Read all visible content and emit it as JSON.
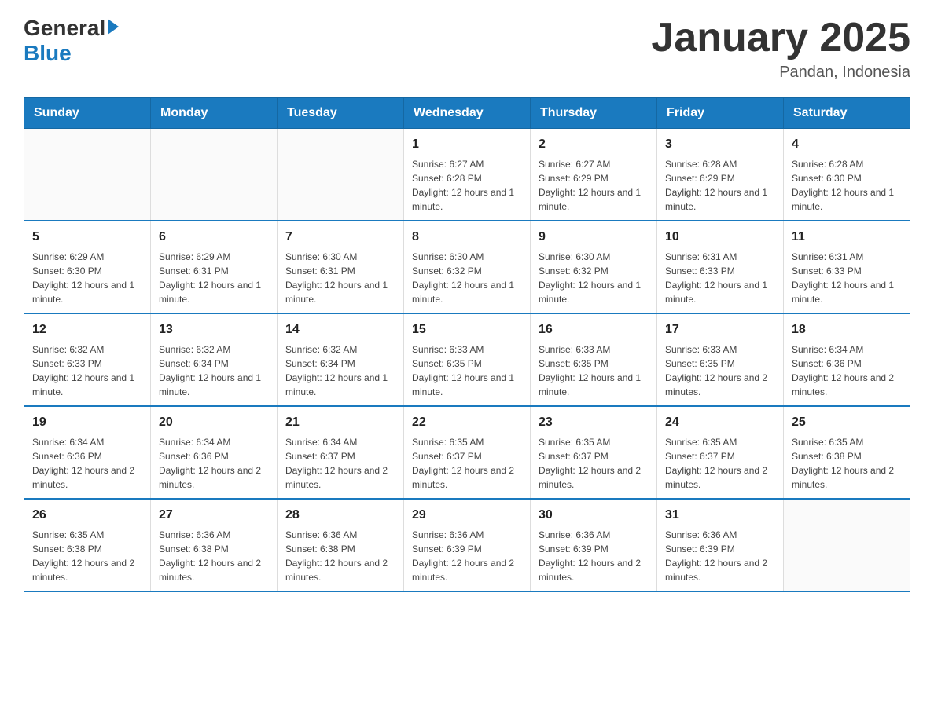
{
  "header": {
    "logo": {
      "general": "General",
      "blue": "Blue"
    },
    "title": "January 2025",
    "subtitle": "Pandan, Indonesia"
  },
  "calendar": {
    "days_of_week": [
      "Sunday",
      "Monday",
      "Tuesday",
      "Wednesday",
      "Thursday",
      "Friday",
      "Saturday"
    ],
    "weeks": [
      [
        {
          "day": "",
          "info": ""
        },
        {
          "day": "",
          "info": ""
        },
        {
          "day": "",
          "info": ""
        },
        {
          "day": "1",
          "info": "Sunrise: 6:27 AM\nSunset: 6:28 PM\nDaylight: 12 hours and 1 minute."
        },
        {
          "day": "2",
          "info": "Sunrise: 6:27 AM\nSunset: 6:29 PM\nDaylight: 12 hours and 1 minute."
        },
        {
          "day": "3",
          "info": "Sunrise: 6:28 AM\nSunset: 6:29 PM\nDaylight: 12 hours and 1 minute."
        },
        {
          "day": "4",
          "info": "Sunrise: 6:28 AM\nSunset: 6:30 PM\nDaylight: 12 hours and 1 minute."
        }
      ],
      [
        {
          "day": "5",
          "info": "Sunrise: 6:29 AM\nSunset: 6:30 PM\nDaylight: 12 hours and 1 minute."
        },
        {
          "day": "6",
          "info": "Sunrise: 6:29 AM\nSunset: 6:31 PM\nDaylight: 12 hours and 1 minute."
        },
        {
          "day": "7",
          "info": "Sunrise: 6:30 AM\nSunset: 6:31 PM\nDaylight: 12 hours and 1 minute."
        },
        {
          "day": "8",
          "info": "Sunrise: 6:30 AM\nSunset: 6:32 PM\nDaylight: 12 hours and 1 minute."
        },
        {
          "day": "9",
          "info": "Sunrise: 6:30 AM\nSunset: 6:32 PM\nDaylight: 12 hours and 1 minute."
        },
        {
          "day": "10",
          "info": "Sunrise: 6:31 AM\nSunset: 6:33 PM\nDaylight: 12 hours and 1 minute."
        },
        {
          "day": "11",
          "info": "Sunrise: 6:31 AM\nSunset: 6:33 PM\nDaylight: 12 hours and 1 minute."
        }
      ],
      [
        {
          "day": "12",
          "info": "Sunrise: 6:32 AM\nSunset: 6:33 PM\nDaylight: 12 hours and 1 minute."
        },
        {
          "day": "13",
          "info": "Sunrise: 6:32 AM\nSunset: 6:34 PM\nDaylight: 12 hours and 1 minute."
        },
        {
          "day": "14",
          "info": "Sunrise: 6:32 AM\nSunset: 6:34 PM\nDaylight: 12 hours and 1 minute."
        },
        {
          "day": "15",
          "info": "Sunrise: 6:33 AM\nSunset: 6:35 PM\nDaylight: 12 hours and 1 minute."
        },
        {
          "day": "16",
          "info": "Sunrise: 6:33 AM\nSunset: 6:35 PM\nDaylight: 12 hours and 1 minute."
        },
        {
          "day": "17",
          "info": "Sunrise: 6:33 AM\nSunset: 6:35 PM\nDaylight: 12 hours and 2 minutes."
        },
        {
          "day": "18",
          "info": "Sunrise: 6:34 AM\nSunset: 6:36 PM\nDaylight: 12 hours and 2 minutes."
        }
      ],
      [
        {
          "day": "19",
          "info": "Sunrise: 6:34 AM\nSunset: 6:36 PM\nDaylight: 12 hours and 2 minutes."
        },
        {
          "day": "20",
          "info": "Sunrise: 6:34 AM\nSunset: 6:36 PM\nDaylight: 12 hours and 2 minutes."
        },
        {
          "day": "21",
          "info": "Sunrise: 6:34 AM\nSunset: 6:37 PM\nDaylight: 12 hours and 2 minutes."
        },
        {
          "day": "22",
          "info": "Sunrise: 6:35 AM\nSunset: 6:37 PM\nDaylight: 12 hours and 2 minutes."
        },
        {
          "day": "23",
          "info": "Sunrise: 6:35 AM\nSunset: 6:37 PM\nDaylight: 12 hours and 2 minutes."
        },
        {
          "day": "24",
          "info": "Sunrise: 6:35 AM\nSunset: 6:37 PM\nDaylight: 12 hours and 2 minutes."
        },
        {
          "day": "25",
          "info": "Sunrise: 6:35 AM\nSunset: 6:38 PM\nDaylight: 12 hours and 2 minutes."
        }
      ],
      [
        {
          "day": "26",
          "info": "Sunrise: 6:35 AM\nSunset: 6:38 PM\nDaylight: 12 hours and 2 minutes."
        },
        {
          "day": "27",
          "info": "Sunrise: 6:36 AM\nSunset: 6:38 PM\nDaylight: 12 hours and 2 minutes."
        },
        {
          "day": "28",
          "info": "Sunrise: 6:36 AM\nSunset: 6:38 PM\nDaylight: 12 hours and 2 minutes."
        },
        {
          "day": "29",
          "info": "Sunrise: 6:36 AM\nSunset: 6:39 PM\nDaylight: 12 hours and 2 minutes."
        },
        {
          "day": "30",
          "info": "Sunrise: 6:36 AM\nSunset: 6:39 PM\nDaylight: 12 hours and 2 minutes."
        },
        {
          "day": "31",
          "info": "Sunrise: 6:36 AM\nSunset: 6:39 PM\nDaylight: 12 hours and 2 minutes."
        },
        {
          "day": "",
          "info": ""
        }
      ]
    ]
  }
}
